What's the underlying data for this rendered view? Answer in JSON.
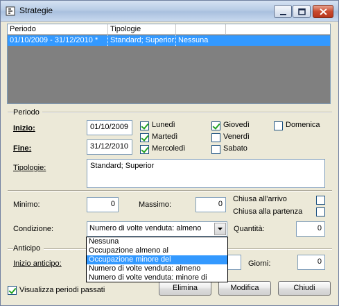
{
  "window": {
    "title": "Strategie"
  },
  "list": {
    "columns": [
      "Periodo",
      "Tipologie",
      ""
    ],
    "rows": [
      {
        "periodo": "01/10/2009 - 31/12/2010 *",
        "tipologie": "Standard; Superior",
        "extra": "Nessuna",
        "selected": true
      }
    ]
  },
  "periodo": {
    "group_label": "Periodo",
    "inizio_label": "Inizio:",
    "inizio_value": "01/10/2009",
    "fine_label": "Fine:",
    "fine_value": "31/12/2010",
    "days": [
      {
        "label": "Lunedì",
        "checked": true
      },
      {
        "label": "Martedì",
        "checked": true
      },
      {
        "label": "Mercoledì",
        "checked": true
      },
      {
        "label": "Giovedì",
        "checked": true
      },
      {
        "label": "Venerdì",
        "checked": false
      },
      {
        "label": "Sabato",
        "checked": false
      },
      {
        "label": "Domenica",
        "checked": false
      }
    ],
    "tipologie_label": "Tipologie:",
    "tipologie_value": "Standard; Superior"
  },
  "limits": {
    "minimo_label": "Minimo:",
    "minimo_value": "0",
    "massimo_label": "Massimo:",
    "massimo_value": "0",
    "chiusa_arrivo_label": "Chiusa all'arrivo",
    "chiusa_arrivo_checked": false,
    "chiusa_partenza_label": "Chiusa alla partenza",
    "chiusa_partenza_checked": false,
    "condizione_label": "Condizione:",
    "condizione_value": "Numero di volte venduta: almeno",
    "condizione_options": [
      "Nessuna",
      "Occupazione almeno al",
      "Occupazione minore del",
      "Numero di volte venduta: almeno",
      "Numero di volte venduta: minore di"
    ],
    "condizione_highlighted": 2,
    "quantita_label": "Quantità:",
    "quantita_value": "0"
  },
  "anticipo": {
    "group_label": "Anticipo",
    "inizio_label": "Inizio anticipo:",
    "giorni_label": "Giorni:",
    "giorni_value": "0"
  },
  "footer": {
    "visualizza_label": "Visualizza periodi passati",
    "visualizza_checked": true,
    "elimina_label": "Elimina",
    "modifica_label": "Modifica",
    "chiudi_label": "Chiudi"
  },
  "colors": {
    "selection": "#3399ff",
    "list_background": "#808080",
    "window": "#ece9d8"
  }
}
